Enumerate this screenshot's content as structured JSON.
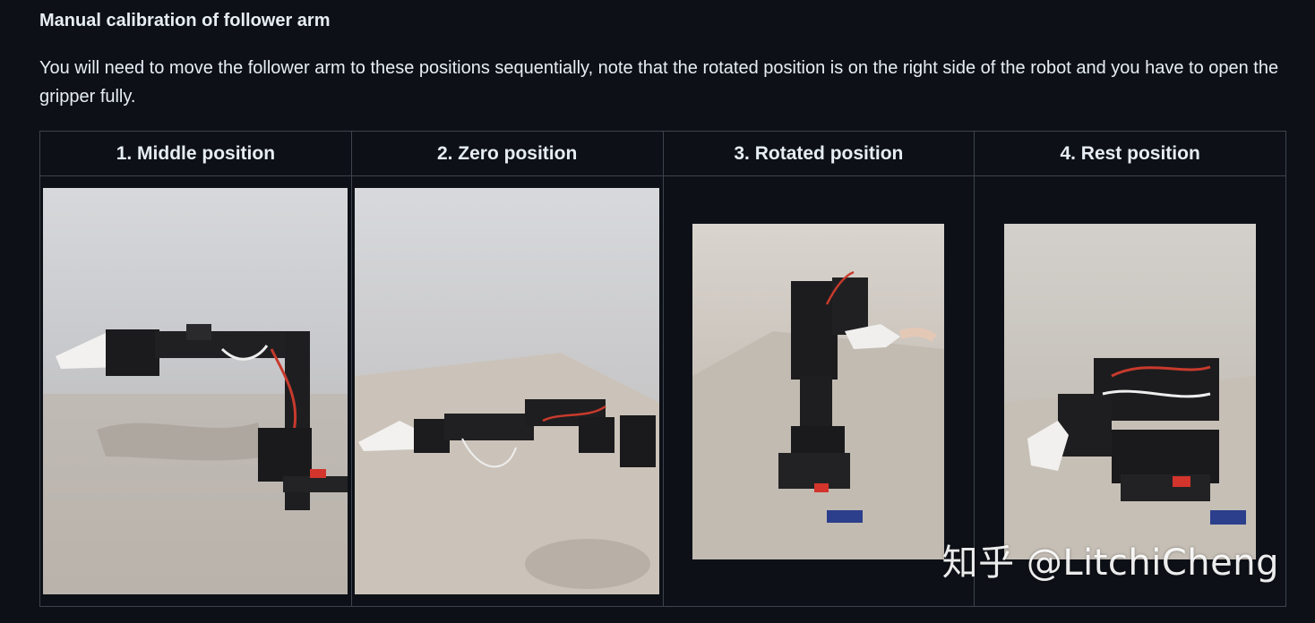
{
  "heading": "Manual calibration of follower arm",
  "paragraph": "You will need to move the follower arm to these positions sequentially, note that the rotated position is on the right side of the robot and you have to open the gripper fully.",
  "table": {
    "headers": [
      "1. Middle position",
      "2. Zero position",
      "3. Rotated position",
      "4. Rest position"
    ]
  },
  "watermark": "知乎 @LitchiCheng",
  "colors": {
    "background": "#0d1117",
    "text": "#e6edf3",
    "border": "#3d444d"
  }
}
